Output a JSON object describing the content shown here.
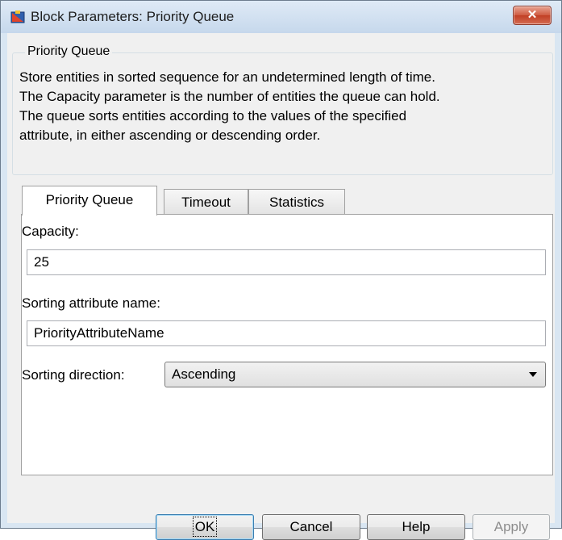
{
  "window": {
    "title": "Block Parameters: Priority Queue",
    "close_glyph": "✕",
    "icon": "simulink-block-icon"
  },
  "group": {
    "title": "Priority Queue",
    "description_lines": [
      "Store entities in sorted sequence for an undetermined length of time.",
      "The Capacity parameter is the number of entities the queue can hold.",
      "The queue sorts entities according to the values of the specified",
      "attribute, in either ascending or descending order."
    ]
  },
  "tabs": [
    {
      "label": "Priority Queue",
      "active": true
    },
    {
      "label": "Timeout",
      "active": false
    },
    {
      "label": "Statistics",
      "active": false
    }
  ],
  "params": {
    "capacity_label": "Capacity:",
    "capacity_value": "25",
    "sort_attr_label": "Sorting attribute name:",
    "sort_attr_value": "PriorityAttributeName",
    "sort_dir_label": "Sorting direction:",
    "sort_dir_value": "Ascending"
  },
  "buttons": {
    "ok": "OK",
    "cancel": "Cancel",
    "help": "Help",
    "apply": "Apply"
  },
  "colors": {
    "title_gradient_top": "#dfeaf6",
    "close_button": "#c13f24",
    "panel": "#ffffff",
    "client": "#f0f0f0"
  }
}
